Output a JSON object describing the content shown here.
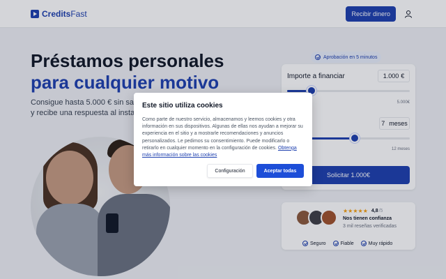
{
  "header": {
    "brand_credits": "Credits",
    "brand_fast": "Fast",
    "receive_button": "Recibir dinero",
    "user_icon": "user-icon"
  },
  "hero": {
    "title_line1": "Préstamos personales",
    "title_line2": "para cualquier motivo",
    "subtitle_line1": "Consigue hasta 5.000 € sin salir",
    "subtitle_line2": "y recibe una respuesta al instante"
  },
  "calculator": {
    "approval_badge": "Aprobación en 5 minutos",
    "amount_label": "Importe a financiar",
    "amount_value": "1.000",
    "amount_currency": "€",
    "amount_level": 0.2,
    "amount_max": "5.000€",
    "term_value": "7",
    "term_unit": "meses",
    "term_level": 0.55,
    "term_max": "12 meses",
    "request_button": "Solicitar  1.000€"
  },
  "trust": {
    "stars": "★★★★★",
    "rating": "4,8",
    "rating_max": "/5",
    "title": "Nos tienen confianza",
    "reviews": "3 mil reseñas verificadas",
    "features": [
      "Seguro",
      "Fiable",
      "Muy rápido"
    ]
  },
  "cookie_modal": {
    "title": "Este sitio utiliza cookies",
    "text": "Como parte de nuestro servicio, almacenamos y leemos cookies y otra información en sus dispositivos. Algunas de ellas nos ayudan a mejorar su experiencia en el sitio y a mostrarle recomendaciones y anuncios personalizados. Le pedimos su consentimiento. Puede modificarlo o retirarlo en cualquier momento en la configuración de cookies.",
    "link": "Obtenga más información sobre las cookies",
    "config_button": "Configuración",
    "accept_button": "Aceptar todas"
  },
  "colors": {
    "brand": "#1e40af",
    "background": "#eef0f4",
    "star": "#f59e0b"
  }
}
